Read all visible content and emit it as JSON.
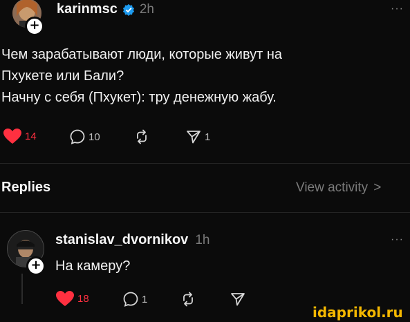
{
  "post": {
    "username": "karinmsc",
    "time": "2h",
    "more": "···",
    "lines": [
      "Чем зарабатывают люди, которые живут на",
      "Пхукете или Бали?",
      "Начну с себя (Пхукет): тру денежную жабу."
    ],
    "likes": "14",
    "comments": "10",
    "shares": "1"
  },
  "replies_header": {
    "title": "Replies",
    "view_activity": "View activity",
    "chevron": ">"
  },
  "reply": {
    "username": "stanislav_dvornikov",
    "time": "1h",
    "more": "···",
    "text": "На камеру?",
    "likes": "18",
    "comments": "1"
  },
  "watermark": "idaprikol.ru",
  "colors": {
    "like": "#ff3040",
    "verified": "#1d9bf0",
    "watermark": "#f5b800"
  }
}
